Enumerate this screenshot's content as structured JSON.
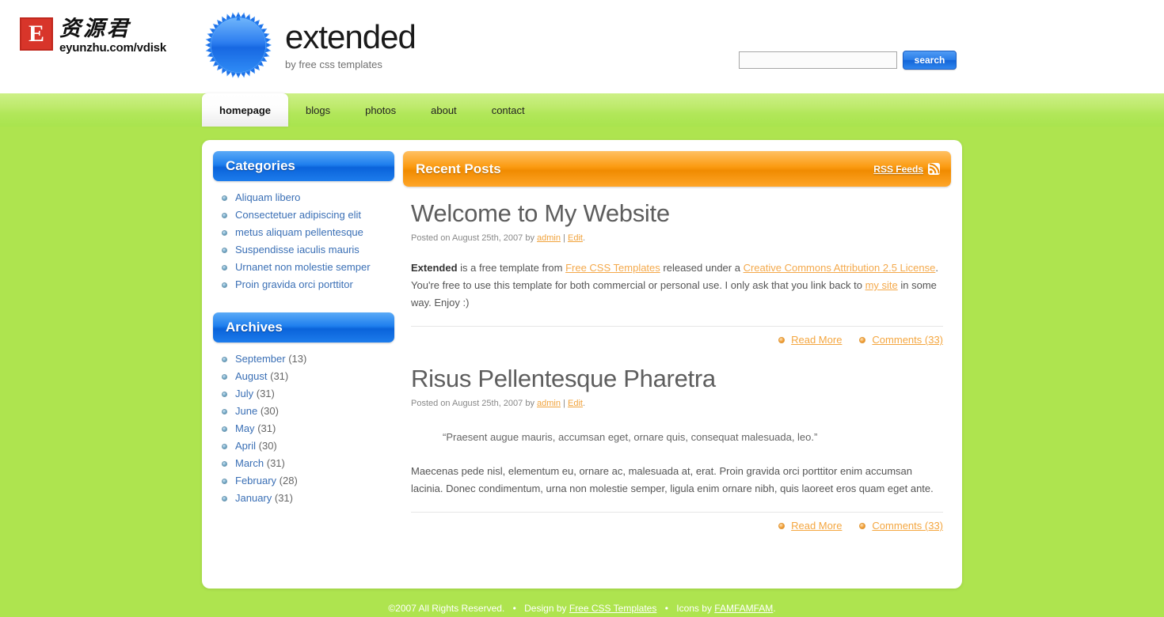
{
  "header": {
    "partner_logo": {
      "mark_letter": "E",
      "cn_title": "资源君",
      "url_text": "eyunzhu.com/vdisk"
    },
    "site_title": "extended",
    "site_tagline": "by free css templates",
    "logo_icon": "starburst-icon"
  },
  "search": {
    "value": "",
    "placeholder": "",
    "button_label": "search"
  },
  "nav": {
    "items": [
      {
        "label": "homepage",
        "active": true
      },
      {
        "label": "blogs",
        "active": false
      },
      {
        "label": "photos",
        "active": false
      },
      {
        "label": "about",
        "active": false
      },
      {
        "label": "contact",
        "active": false
      }
    ]
  },
  "sidebar": {
    "categories": {
      "title": "Categories",
      "items": [
        "Aliquam libero",
        "Consectetuer adipiscing elit",
        "metus aliquam pellentesque",
        "Suspendisse iaculis mauris",
        "Urnanet non molestie semper",
        "Proin gravida orci porttitor"
      ]
    },
    "archives": {
      "title": "Archives",
      "items": [
        {
          "label": "September",
          "count": "(13)"
        },
        {
          "label": "August",
          "count": "(31)"
        },
        {
          "label": "July",
          "count": "(31)"
        },
        {
          "label": "June",
          "count": "(30)"
        },
        {
          "label": "May",
          "count": "(31)"
        },
        {
          "label": "April",
          "count": "(30)"
        },
        {
          "label": "March",
          "count": "(31)"
        },
        {
          "label": "February",
          "count": "(28)"
        },
        {
          "label": "January",
          "count": "(31)"
        }
      ]
    }
  },
  "main": {
    "title": "Recent Posts",
    "rss_label": "RSS Feeds",
    "rss_icon": "rss-feed-icon",
    "posts": [
      {
        "title": "Welcome to My Website",
        "meta_prefix": "Posted on August 25th, 2007 by",
        "author": "admin",
        "meta_separator": "|",
        "edit_label": "Edit",
        "meta_suffix": ".",
        "body_lead": "Extended",
        "body_part1": " is a free template from ",
        "link1": "Free CSS Templates",
        "body_part2": " released under a ",
        "link2": "Creative Commons Attribution 2.5 License",
        "body_part3": ". You're free to use this template for both commercial or personal use. I only ask that you link back to ",
        "link3": "my site",
        "body_part4": " in some way. Enjoy :)",
        "read_more": "Read More",
        "comments": "Comments (33)"
      },
      {
        "title": "Risus Pellentesque Pharetra",
        "meta_prefix": "Posted on August 25th, 2007 by",
        "author": "admin",
        "meta_separator": "|",
        "edit_label": "Edit",
        "meta_suffix": ".",
        "quote": "“Praesent augue mauris, accumsan eget, ornare quis, consequat malesuada, leo.”",
        "body": "Maecenas pede nisl, elementum eu, ornare ac, malesuada at, erat. Proin gravida orci porttitor enim accumsan lacinia. Donec condimentum, urna non molestie semper, ligula enim ornare nibh, quis laoreet eros quam eget ante.",
        "read_more": "Read More",
        "comments": "Comments (33)"
      }
    ]
  },
  "footer": {
    "copyright": "©2007 All Rights Reserved.",
    "dot1": "•",
    "design_by": "Design by",
    "design_link": "Free CSS Templates",
    "dot2": "•",
    "icons_by": "Icons by",
    "icons_link": "FAMFAMFAM",
    "period": "."
  },
  "colors": {
    "green": "#aee44f",
    "green_light": "#cdf087",
    "blue": "#1f7fee",
    "orange": "#fb9a10",
    "link_orange": "#f4a63f",
    "link_blue": "#3a6fb5"
  }
}
